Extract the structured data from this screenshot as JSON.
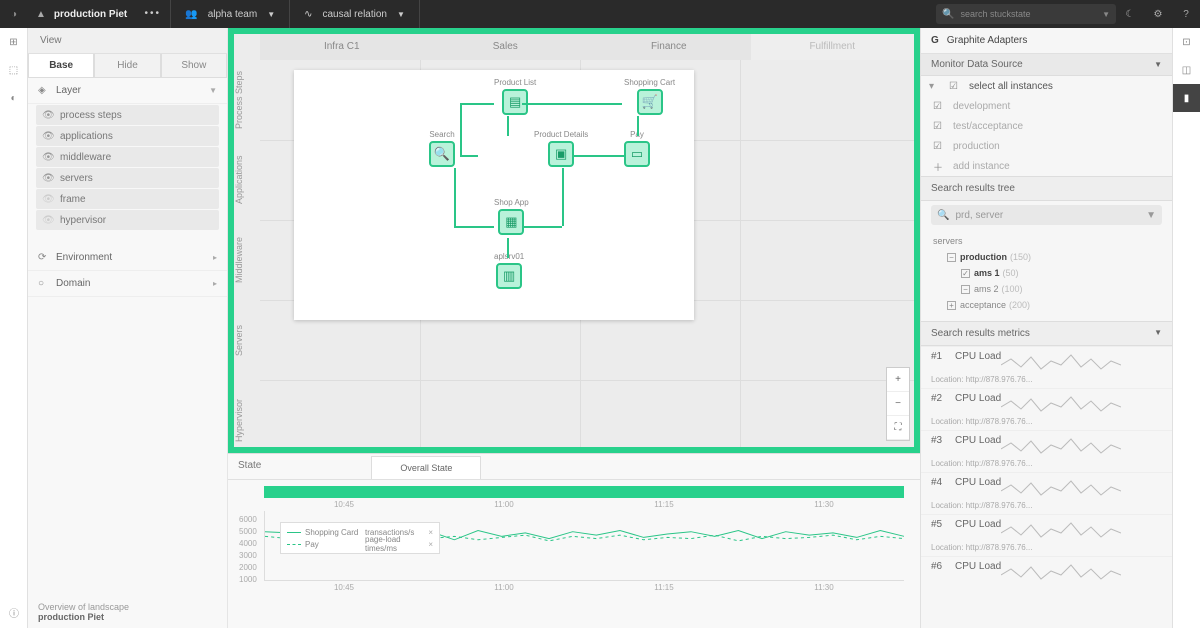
{
  "topbar": {
    "project": "production Piet",
    "team": "alpha team",
    "relation": "causal relation",
    "search_placeholder": "search stuckstate"
  },
  "sidebar": {
    "title": "View",
    "tabs": [
      "Base",
      "Hide",
      "Show"
    ],
    "layer_label": "Layer",
    "layers": [
      {
        "label": "process steps",
        "on": true
      },
      {
        "label": "applications",
        "on": true
      },
      {
        "label": "middleware",
        "on": true
      },
      {
        "label": "servers",
        "on": true
      },
      {
        "label": "frame",
        "on": false
      },
      {
        "label": "hypervisor",
        "on": false
      }
    ],
    "env_label": "Environment",
    "domain_label": "Domain",
    "footer_line1": "Overview of landscape",
    "footer_line2": "production Piet"
  },
  "canvas": {
    "col_tabs": [
      "Infra C1",
      "Sales",
      "Finance",
      "Fulfillment"
    ],
    "row_labels": [
      "Process Steps",
      "Applications",
      "Middleware",
      "Servers",
      "Hypervisor"
    ],
    "nodes": {
      "product_list": "Product List",
      "shopping_cart": "Shopping Cart",
      "search": "Search",
      "product_details": "Product Details",
      "pay": "Pay",
      "shop_app": "Shop App",
      "server": "aplsrv01"
    }
  },
  "state": {
    "title": "State",
    "tab": "Overall State",
    "x_ticks": [
      "10:45",
      "11:00",
      "11:15",
      "11:30"
    ],
    "y_ticks": [
      "6000",
      "5000",
      "4000",
      "3000",
      "2000",
      "1000"
    ],
    "legend": [
      {
        "name": "Shopping Card",
        "metric": "transactions/s",
        "style": "solid"
      },
      {
        "name": "Pay",
        "metric": "page-load times/ms",
        "style": "dash"
      }
    ]
  },
  "right": {
    "title": "Graphite Adapters",
    "sub": "Monitor Data Source",
    "select_all": "select all instances",
    "instances": [
      "development",
      "test/acceptance",
      "production"
    ],
    "add": "add instance",
    "tree_title": "Search results tree",
    "search2": "prd, server",
    "tree": {
      "root": "servers",
      "prod": "production",
      "prod_cnt": "(150)",
      "ams1": "ams 1",
      "ams1_cnt": "(50)",
      "ams2": "ams 2",
      "ams2_cnt": "(100)",
      "acc": "acceptance",
      "acc_cnt": "(200)"
    },
    "metrics_title": "Search results metrics",
    "metrics": [
      {
        "rank": "#1",
        "name": "CPU Load",
        "loc": "Location: http://878.976.76..."
      },
      {
        "rank": "#2",
        "name": "CPU Load",
        "loc": "Location: http://878.976.76..."
      },
      {
        "rank": "#3",
        "name": "CPU Load",
        "loc": "Location: http://878.976.76..."
      },
      {
        "rank": "#4",
        "name": "CPU Load",
        "loc": "Location: http://878.976.76..."
      },
      {
        "rank": "#5",
        "name": "CPU Load",
        "loc": "Location: http://878.976.76..."
      },
      {
        "rank": "#6",
        "name": "CPU Load",
        "loc": ""
      }
    ]
  },
  "chart_data": {
    "type": "line",
    "x_ticks": [
      "10:45",
      "11:00",
      "11:15",
      "11:30"
    ],
    "ylim": [
      0,
      6000
    ],
    "series": [
      {
        "name": "Shopping Card",
        "unit": "transactions/s",
        "style": "solid",
        "values": [
          4200,
          4100,
          3800,
          4300,
          3600,
          4400,
          3700,
          4200,
          3500,
          4300,
          3800,
          4100,
          3600,
          4200,
          3900,
          4300,
          3700,
          4000,
          4200,
          3800,
          4300,
          3600,
          4200,
          3900,
          4100,
          3700,
          4300,
          3800
        ]
      },
      {
        "name": "Pay",
        "unit": "page-load times/ms",
        "style": "dash",
        "values": [
          3800,
          3600,
          3900,
          3500,
          4000,
          3400,
          3900,
          3600,
          3800,
          3500,
          3700,
          3900,
          3400,
          3800,
          3600,
          3900,
          3500,
          3700,
          3600,
          3900,
          3400,
          3800,
          3600,
          3700,
          3900,
          3500,
          3800,
          3600
        ]
      }
    ]
  }
}
